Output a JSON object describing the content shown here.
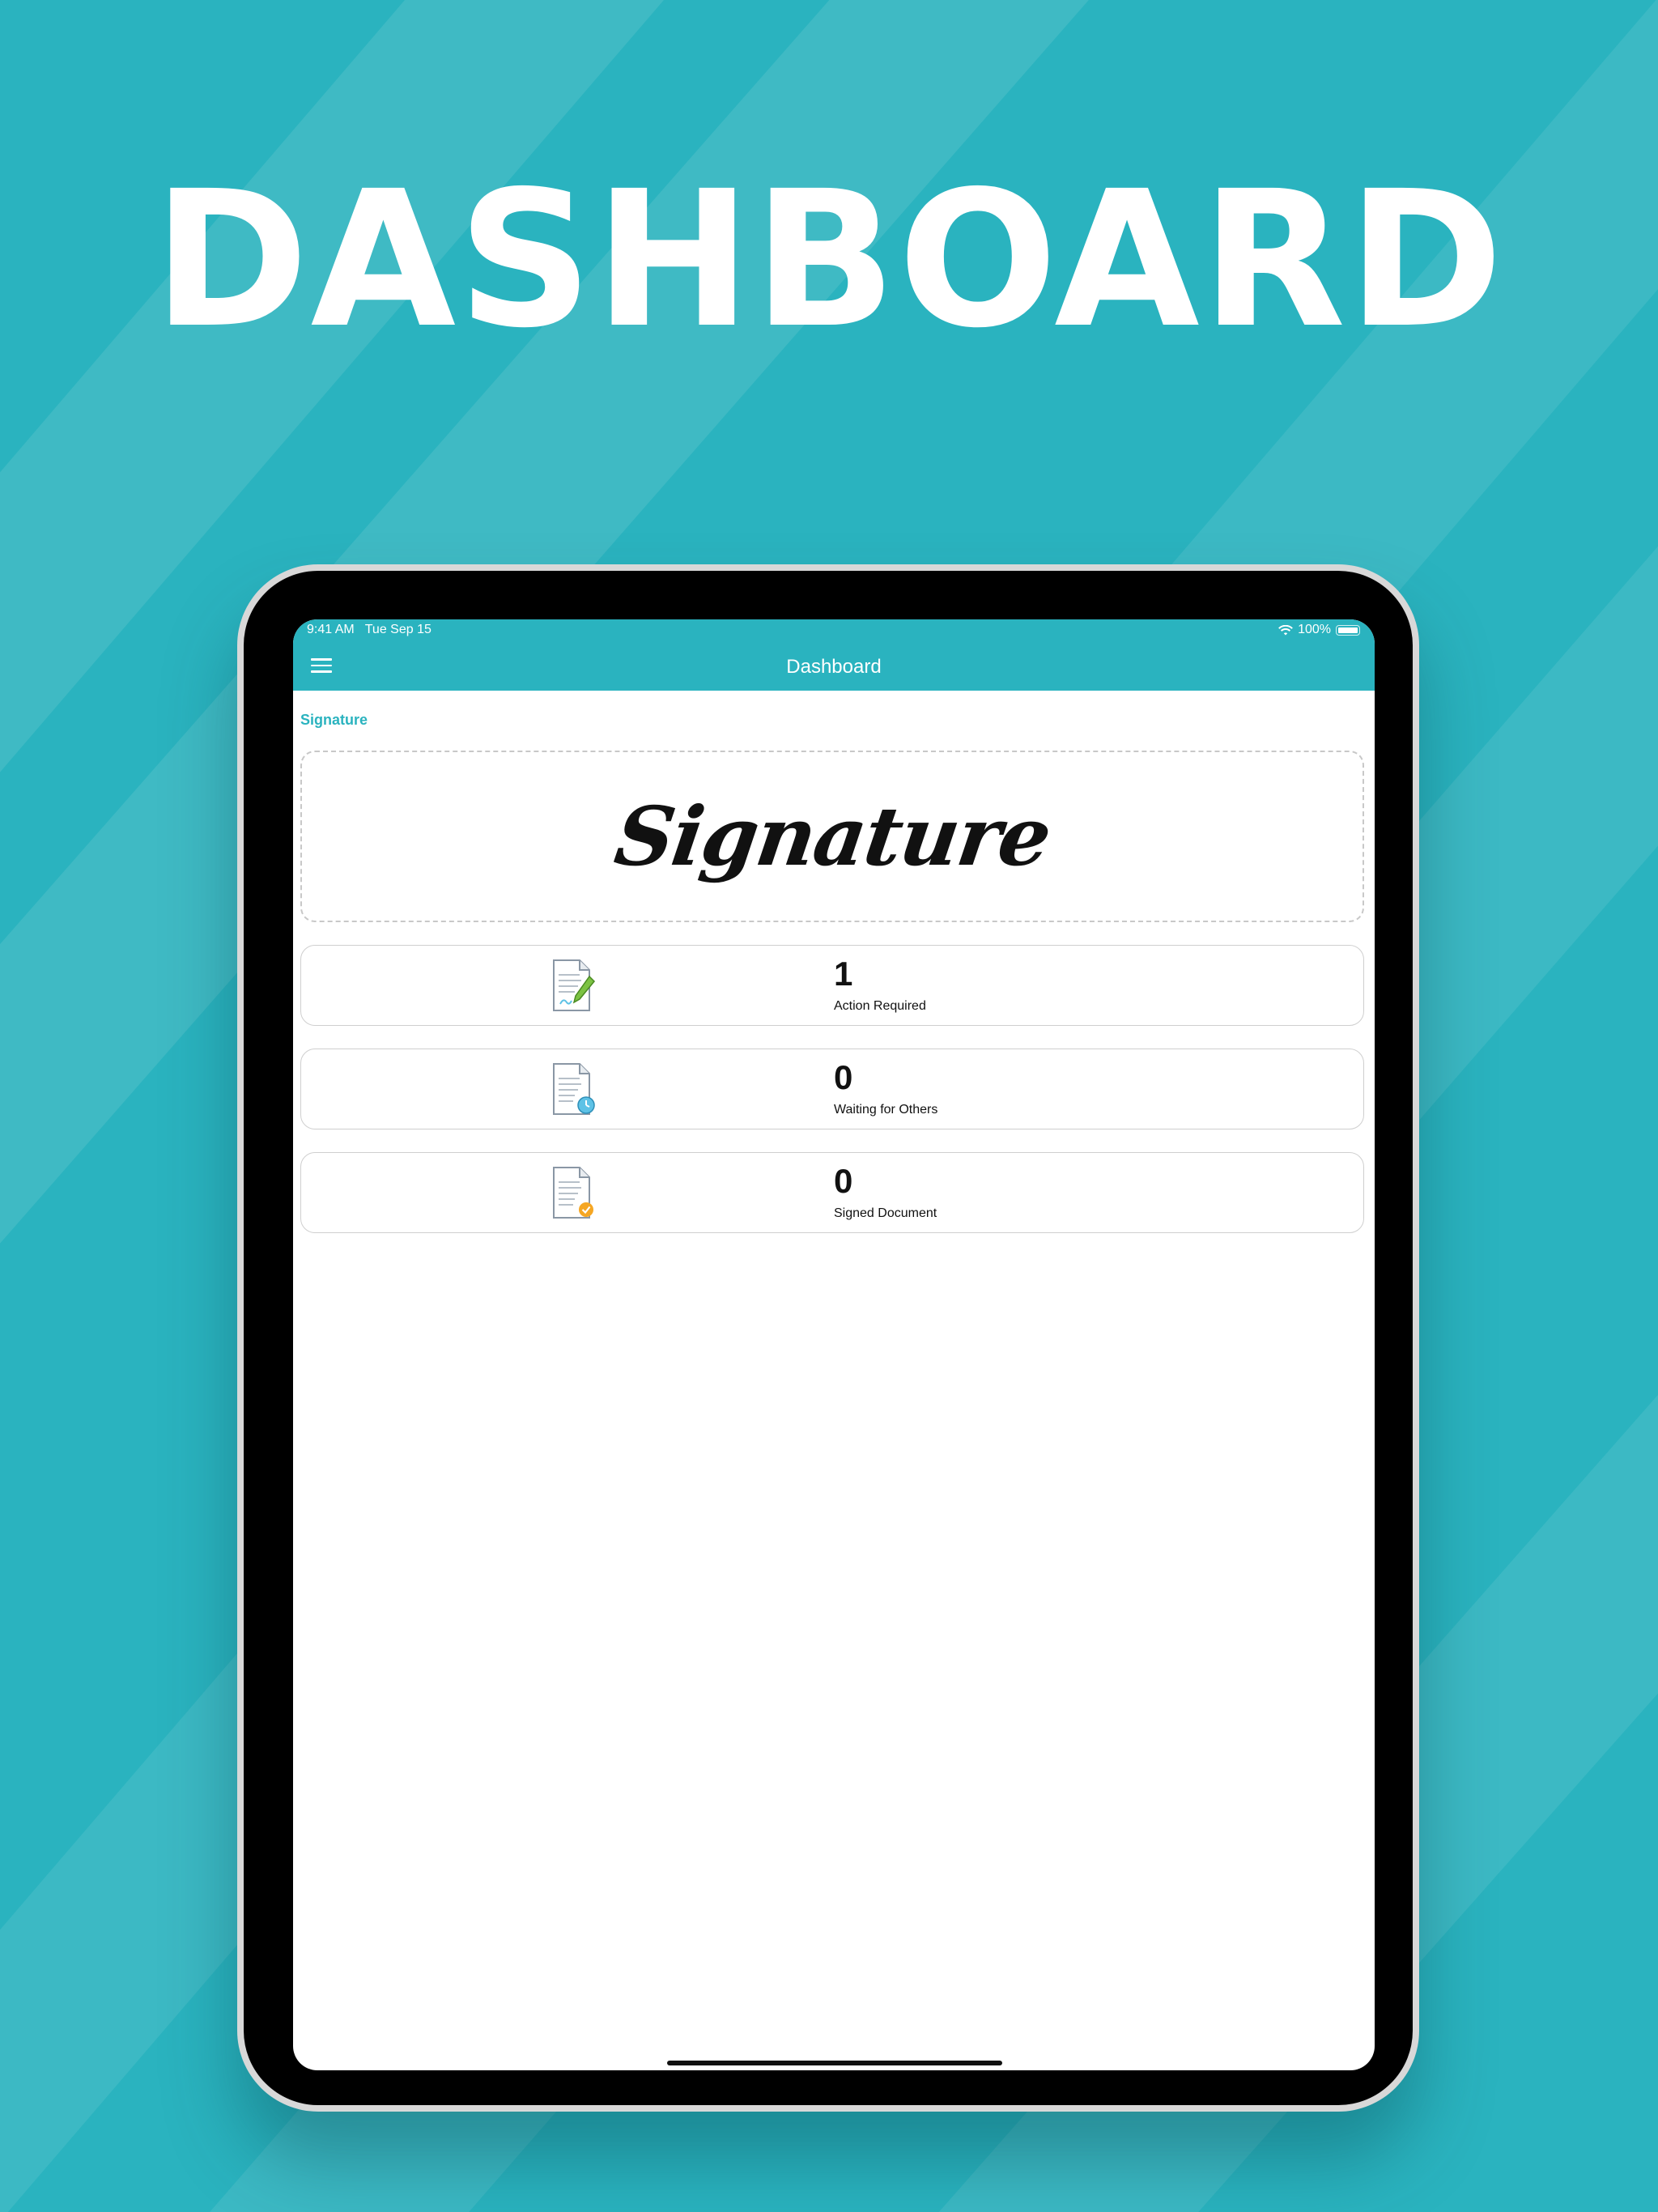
{
  "headline": "DASHBOARD",
  "colors": {
    "accent": "#2ab3bf",
    "background": "#2ab3bf",
    "stripe": "#45bcc6",
    "signed_badge": "#f5a623",
    "waiting_badge": "#5ec2e6",
    "pen": "#7cc243"
  },
  "status_bar": {
    "time": "9:41 AM",
    "date": "Tue Sep 15",
    "battery": "100%",
    "icons": [
      "wifi-icon",
      "battery-icon"
    ]
  },
  "navbar": {
    "title": "Dashboard",
    "menu_icon": "hamburger-menu-icon"
  },
  "signature_section": {
    "label": "Signature",
    "signature_text": "Signature"
  },
  "stats": [
    {
      "value": "1",
      "label": "Action Required",
      "icon": "document-pen-icon"
    },
    {
      "value": "0",
      "label": "Waiting for Others",
      "icon": "document-clock-icon"
    },
    {
      "value": "0",
      "label": "Signed Document",
      "icon": "document-check-icon"
    }
  ]
}
